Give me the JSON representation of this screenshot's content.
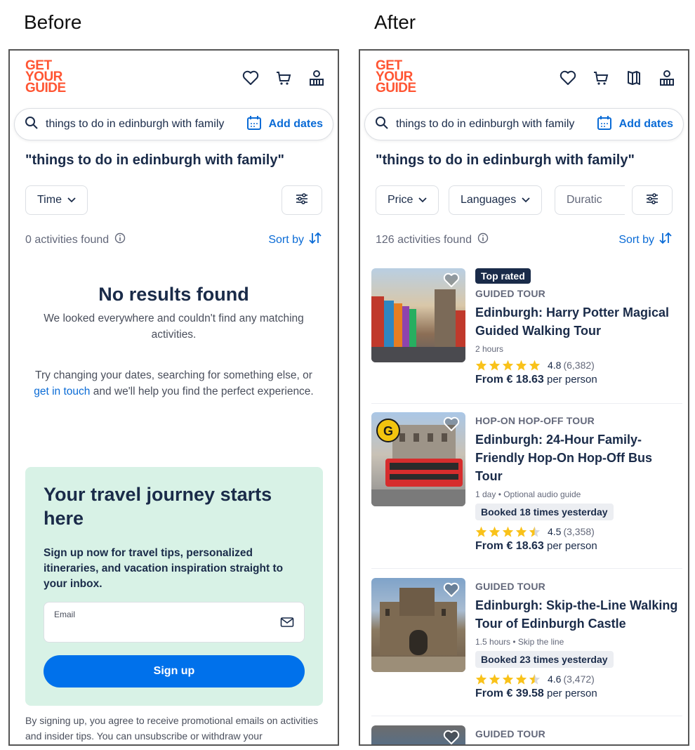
{
  "labels": {
    "before": "Before",
    "after": "After"
  },
  "brand": {
    "line1": "GET",
    "line2": "YOUR",
    "line3": "GUIDE"
  },
  "search": {
    "query": "things to do in edinburgh with family",
    "dates": "Add dates"
  },
  "query_title": "\"things to do in edinburgh with family\"",
  "before": {
    "filters": [
      "Time"
    ],
    "count": "0 activities found",
    "sort": "Sort by",
    "no_results_title": "No results found",
    "no_results_text": "We looked everywhere and couldn't find any matching activities.",
    "try_text_1": "Try changing your dates, searching for something else, or",
    "try_link": "get in touch",
    "try_text_2": "and we'll help you find the perfect experience.",
    "signup": {
      "heading": "Your travel journey starts here",
      "subtext": "Sign up now for travel tips, personalized itineraries, and vacation inspiration straight to your inbox.",
      "email_label": "Email",
      "button": "Sign up"
    },
    "legal": "By signing up, you agree to receive promotional emails on activities and insider tips. You can unsubscribe or withdraw your"
  },
  "after": {
    "filters": [
      "Price",
      "Languages",
      "Duratic"
    ],
    "count": "126 activities found",
    "sort": "Sort by",
    "results": [
      {
        "badge": "Top rated",
        "category": "GUIDED TOUR",
        "title": "Edinburgh: Harry Potter Magical Guided Walking Tour",
        "meta": "2 hours",
        "booked": "",
        "rating": "4.8",
        "rating_stars": 4.8,
        "reviews": "(6,382)",
        "price_prefix": "From € 18.63",
        "price_suffix": "per person"
      },
      {
        "badge": "",
        "category": "HOP-ON HOP-OFF TOUR",
        "title": "Edinburgh: 24-Hour Family-Friendly Hop-On Hop-Off Bus Tour",
        "meta": "1 day • Optional audio guide",
        "booked": "Booked 18 times yesterday",
        "rating": "4.5",
        "rating_stars": 4.5,
        "reviews": "(3,358)",
        "price_prefix": "From € 18.63",
        "price_suffix": "per person"
      },
      {
        "badge": "",
        "category": "GUIDED TOUR",
        "title": "Edinburgh: Skip-the-Line Walking Tour of Edinburgh Castle",
        "meta": "1.5 hours • Skip the line",
        "booked": "Booked 23 times yesterday",
        "rating": "4.6",
        "rating_stars": 4.6,
        "reviews": "(3,472)",
        "price_prefix": "From € 39.58",
        "price_suffix": "per person"
      },
      {
        "category": "GUIDED TOUR"
      }
    ]
  },
  "colors": {
    "brand": "#ff5533",
    "link": "#0a6bd6",
    "signup_bg": "#d8f2e6",
    "button": "#0071eb",
    "star": "#f9c21a"
  }
}
